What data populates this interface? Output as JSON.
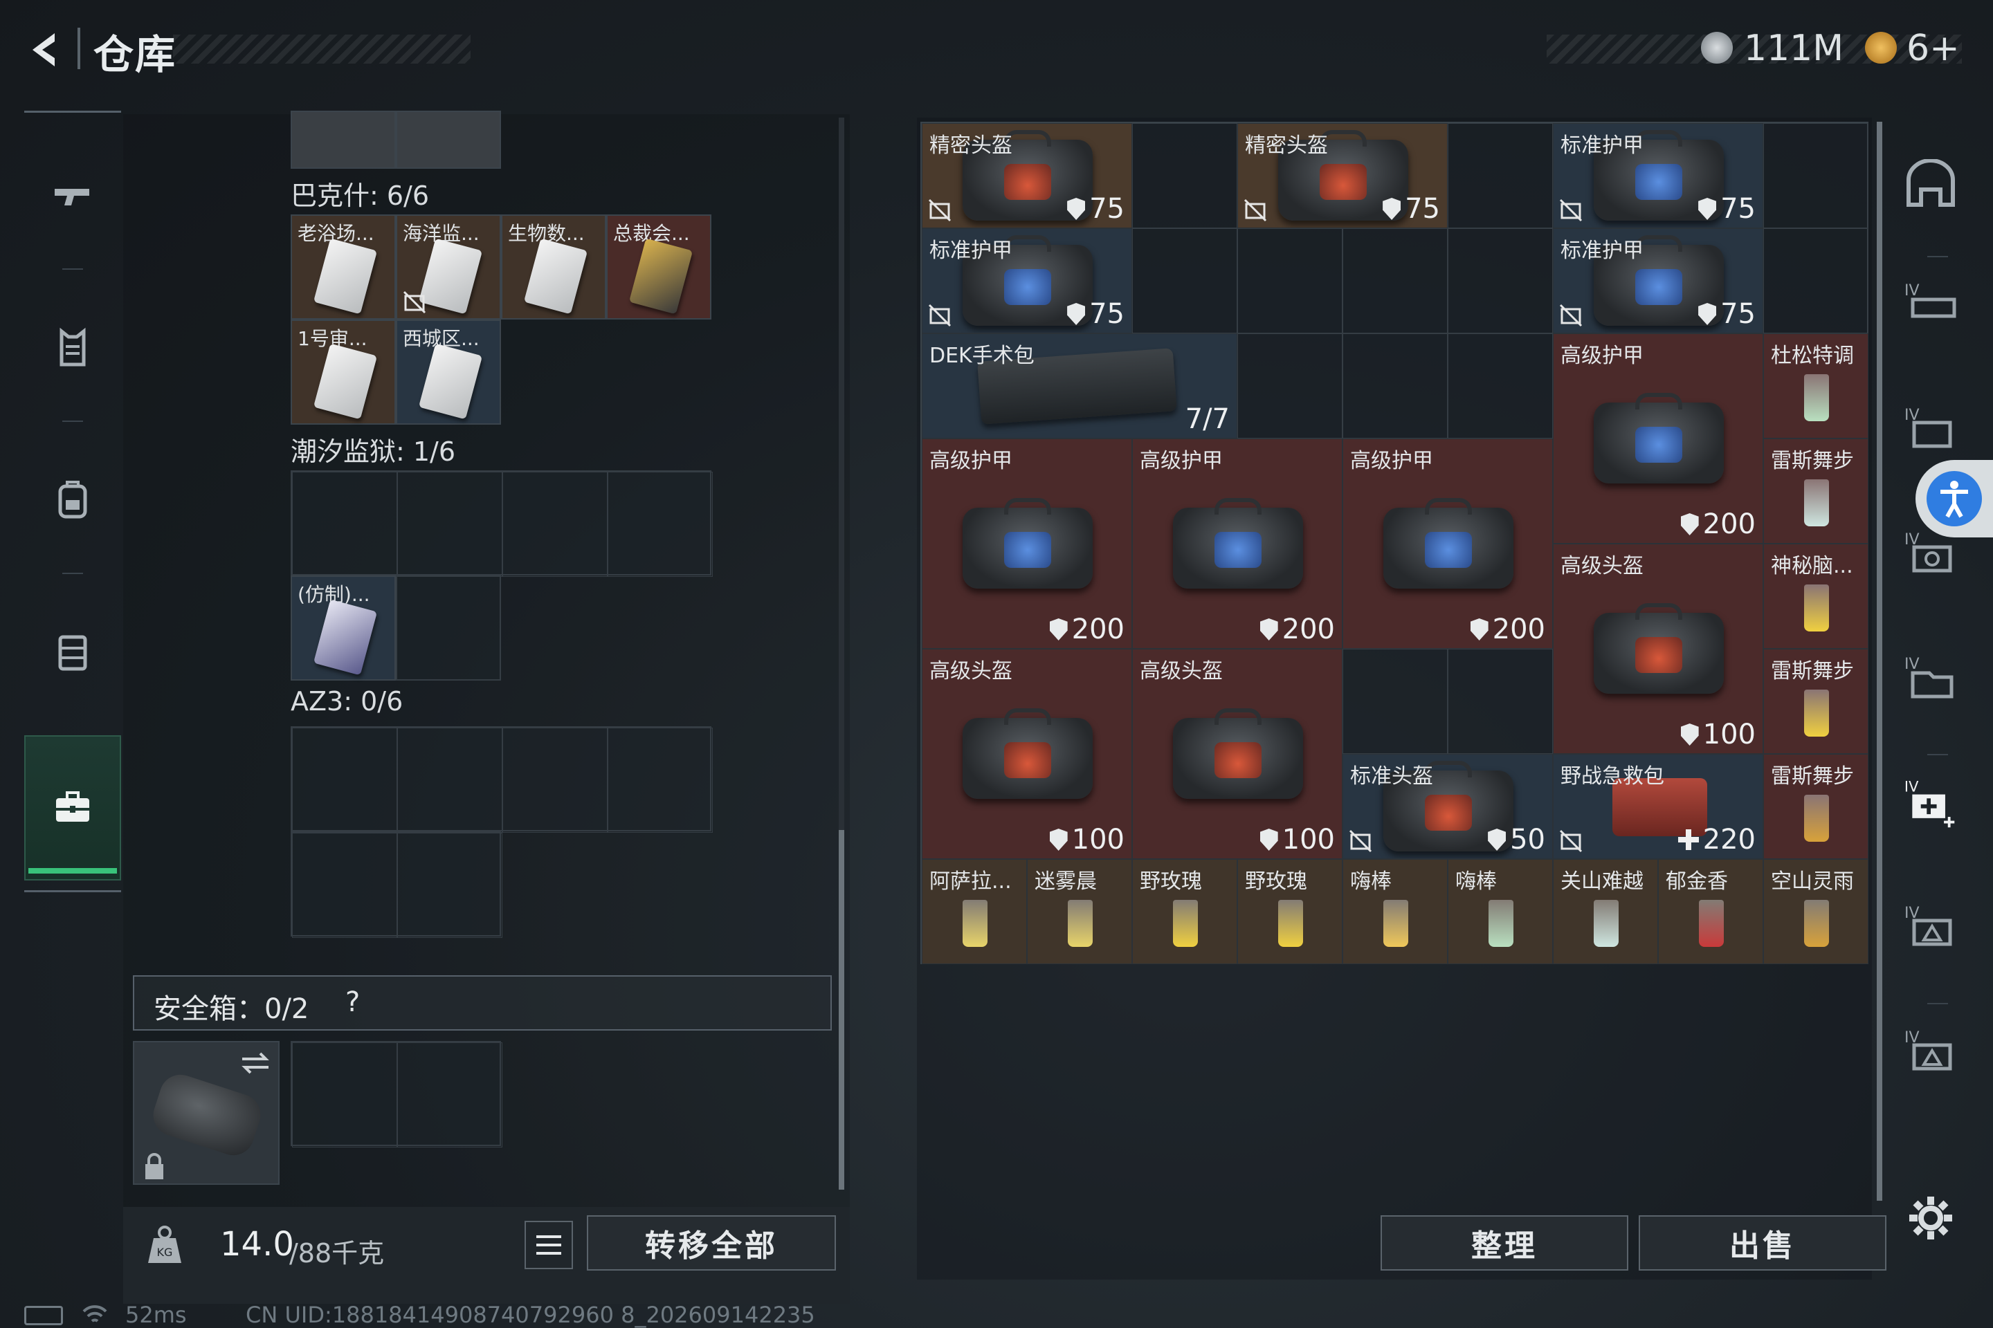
{
  "header": {
    "title": "仓库",
    "currency_amount": "111M",
    "tickets_amount": "6+",
    "coin_color": "#b9bfc4",
    "ticket_color": "#d99b2b"
  },
  "left_nav": {
    "items": [
      "pistol-icon",
      "vest-icon",
      "backpack-icon",
      "rig-icon",
      "case-icon"
    ],
    "active_index": 4,
    "accent": "#39c27a"
  },
  "collections": [
    {
      "label": "巴克什: 6/6",
      "items": [
        "老浴场...",
        "海洋监...",
        "生物数...",
        "总裁会...",
        "1号审...",
        "西城区..."
      ]
    },
    {
      "label": "潮汐监狱: 1/6",
      "items": [
        "(仿制)..."
      ]
    },
    {
      "label": "AZ3: 0/6",
      "items": []
    }
  ],
  "safe_box": {
    "label": "安全箱：0/2",
    "help": "?"
  },
  "weight": {
    "current": "14.0",
    "max": "/88千克"
  },
  "buttons": {
    "transfer_all": "转移全部",
    "organize": "整理",
    "sell": "出售"
  },
  "storage_items": [
    {
      "name": "精密头盔",
      "value": "75",
      "kind": "helmet",
      "bg": "#4a3a2c"
    },
    {
      "name": "精密头盔",
      "value": "75",
      "kind": "helmet",
      "bg": "#4a3a2c"
    },
    {
      "name": "标准护甲",
      "value": "75",
      "kind": "armor",
      "bg": "#283542"
    },
    {
      "name": "标准护甲",
      "value": "75",
      "kind": "armor",
      "bg": "#283542"
    },
    {
      "name": "标准护甲",
      "value": "75",
      "kind": "armor",
      "bg": "#283542"
    },
    {
      "name": "DEK手术包",
      "value": "7/7",
      "kind": "surgery",
      "bg": "#283542"
    },
    {
      "name": "高级护甲",
      "value": "200",
      "kind": "armor",
      "bg": "#4b2a2a"
    },
    {
      "name": "杜松特调",
      "value": "",
      "kind": "drink",
      "bg": "#4b2a2a"
    },
    {
      "name": "雷斯舞步",
      "value": "",
      "kind": "drink",
      "bg": "#4b2a2a"
    },
    {
      "name": "高级护甲",
      "value": "200",
      "kind": "armor",
      "bg": "#4b2a2a"
    },
    {
      "name": "高级护甲",
      "value": "200",
      "kind": "armor",
      "bg": "#4b2a2a"
    },
    {
      "name": "高级护甲",
      "value": "200",
      "kind": "armor",
      "bg": "#4b2a2a"
    },
    {
      "name": "高级头盔",
      "value": "100",
      "kind": "helmet",
      "bg": "#4b2a2a"
    },
    {
      "name": "神秘脑...",
      "value": "",
      "kind": "drink",
      "bg": "#4b2a2a"
    },
    {
      "name": "雷斯舞步",
      "value": "",
      "kind": "drink",
      "bg": "#4b2a2a"
    },
    {
      "name": "高级头盔",
      "value": "100",
      "kind": "helmet",
      "bg": "#4b2a2a"
    },
    {
      "name": "高级头盔",
      "value": "100",
      "kind": "helmet",
      "bg": "#4b2a2a"
    },
    {
      "name": "标准头盔",
      "value": "50",
      "kind": "helmet",
      "bg": "#283542"
    },
    {
      "name": "野战急救包",
      "value": "220",
      "kind": "medkit",
      "bg": "#283542"
    },
    {
      "name": "雷斯舞步",
      "value": "",
      "kind": "drink",
      "bg": "#4b2a2a"
    },
    {
      "name": "阿萨拉...",
      "value": "",
      "kind": "drink",
      "bg": "#40352a"
    },
    {
      "name": "迷雾晨",
      "value": "",
      "kind": "drink",
      "bg": "#40352a"
    },
    {
      "name": "野玫瑰",
      "value": "",
      "kind": "drink",
      "bg": "#40352a"
    },
    {
      "name": "野玫瑰",
      "value": "",
      "kind": "drink",
      "bg": "#40352a"
    },
    {
      "name": "嗨棒",
      "value": "",
      "kind": "drink",
      "bg": "#40352a"
    },
    {
      "name": "嗨棒",
      "value": "",
      "kind": "drink",
      "bg": "#40352a"
    },
    {
      "name": "关山难越",
      "value": "",
      "kind": "drink",
      "bg": "#40352a"
    },
    {
      "name": "郁金香",
      "value": "",
      "kind": "drink",
      "bg": "#40352a"
    },
    {
      "name": "空山灵雨",
      "value": "",
      "kind": "drink",
      "bg": "#40352a"
    }
  ],
  "right_tabs": [
    "home-icon",
    "stash-tab-1-icon",
    "stash-tab-2-icon",
    "stash-tab-3-icon",
    "stash-tab-4-icon",
    "add-stash-icon",
    "stash-tab-5-icon",
    "stash-tab-6-icon"
  ],
  "status_bar": {
    "ping": "52ms",
    "uid": "CN UID:18818414908740792960 8_202609142235"
  }
}
